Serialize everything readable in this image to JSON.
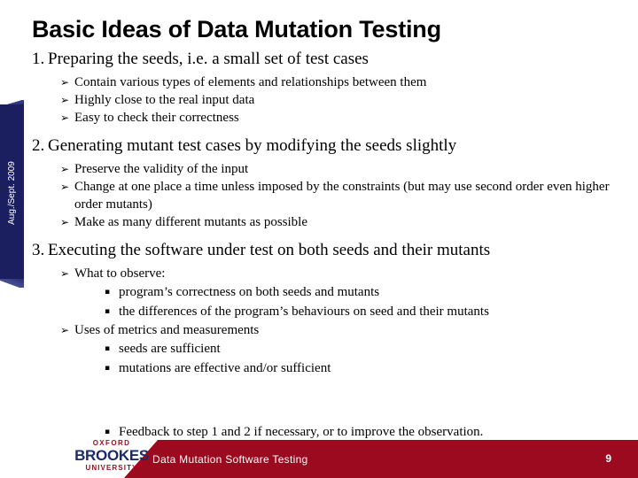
{
  "slide": {
    "title": "Basic Ideas of Data Mutation Testing",
    "page_number": "9",
    "side_tab_label": "Aug./Sept. 2009",
    "colors": {
      "side_tab_navy": "#1b1f60",
      "footer_red": "#9b0a1e",
      "logo_navy": "#1b2a6b"
    }
  },
  "footer": {
    "title": "Data Mutation Software Testing",
    "logo": {
      "line1": "OXFORD",
      "line2": "BROOKES",
      "line3": "UNIVERSITY"
    }
  },
  "bullets": {
    "item1": {
      "number": "1.",
      "text": "Preparing the seeds, i.e. a small set of test cases",
      "sub": [
        "Contain various types of elements and relationships between them",
        "Highly close to the real input data",
        "Easy to check their correctness"
      ]
    },
    "item2": {
      "number": "2.",
      "text": "Generating mutant test cases by modifying the seeds slightly",
      "sub": [
        "Preserve the validity of the input",
        "Change at one place a time unless imposed by the constraints (but may use second order even higher order mutants)",
        "Make as many different mutants as possible"
      ]
    },
    "item3": {
      "number": "3.",
      "text": "Executing the software under test on both seeds and their mutants",
      "sub_a": "What to observe:",
      "sub_a_items": [
        "program’s correctness on both seeds and mutants",
        "the differences of the program’s behaviours on seed and their mutants"
      ],
      "sub_b": "Uses of metrics and measurements",
      "sub_b_items": [
        "seeds are sufficient",
        "mutations are effective and/or sufficient",
        "Feedback to step 1 and 2 if necessary, or to improve the observation."
      ]
    }
  },
  "icons": {
    "arrow_bullet": "➢",
    "square_bullet": "▪"
  }
}
